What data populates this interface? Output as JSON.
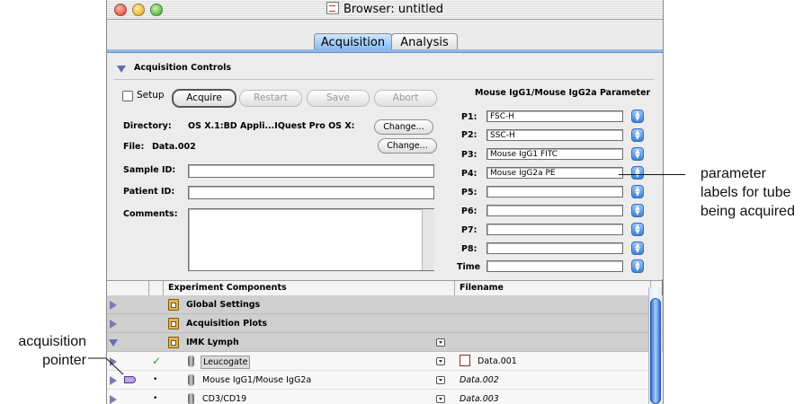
{
  "window": {
    "title": "Browser: untitled",
    "tabs": [
      {
        "label": "Acquisition",
        "active": true
      },
      {
        "label": "Analysis",
        "active": false
      }
    ]
  },
  "acquisition_controls": {
    "header": "Acquisition Controls",
    "setup_label": "Setup",
    "setup_checked": false,
    "buttons": {
      "acquire": "Acquire",
      "restart": "Restart",
      "save": "Save",
      "abort": "Abort"
    },
    "directory_label": "Directory:",
    "directory_value": "OS X.1:BD Appli...IQuest Pro OS X:",
    "file_label": "File:",
    "file_value": "Data.002",
    "change_label": "Change...",
    "sample_id_label": "Sample ID:",
    "sample_id_value": "",
    "patient_id_label": "Patient ID:",
    "patient_id_value": "",
    "comments_label": "Comments:",
    "comments_value": ""
  },
  "parameters": {
    "header": "Mouse IgG1/Mouse IgG2a Parameter",
    "rows": [
      {
        "label": "P1:",
        "value": "FSC-H"
      },
      {
        "label": "P2:",
        "value": "SSC-H"
      },
      {
        "label": "P3:",
        "value": "Mouse IgG1 FITC"
      },
      {
        "label": "P4:",
        "value": "Mouse IgG2a PE"
      },
      {
        "label": "P5:",
        "value": ""
      },
      {
        "label": "P6:",
        "value": ""
      },
      {
        "label": "P7:",
        "value": ""
      },
      {
        "label": "P8:",
        "value": ""
      },
      {
        "label": "Time",
        "value": ""
      }
    ]
  },
  "components": {
    "col_components": "Experiment Components",
    "col_filename": "Filename",
    "rows": [
      {
        "name": "Global Settings",
        "filename": "",
        "expanded": false
      },
      {
        "name": "Acquisition Plots",
        "filename": "",
        "expanded": false
      },
      {
        "name": "IMK Lymph",
        "filename": "",
        "expanded": true
      },
      {
        "name": "Leucogate",
        "filename": "Data.001",
        "status": "✓"
      },
      {
        "name": "Mouse IgG1/Mouse IgG2a",
        "filename": "Data.002",
        "status": "•"
      },
      {
        "name": "CD3/CD19",
        "filename": "Data.003",
        "status": "•"
      }
    ]
  },
  "annotations": {
    "parameter_note": [
      "parameter",
      "labels for tube",
      "being acquired"
    ],
    "pointer_note": [
      "acquisition",
      "pointer"
    ]
  },
  "colors": {
    "accent_blue": "#3b82d6",
    "check_green": "#2a9a2a",
    "pointer_fill": "#b8a8e8"
  }
}
